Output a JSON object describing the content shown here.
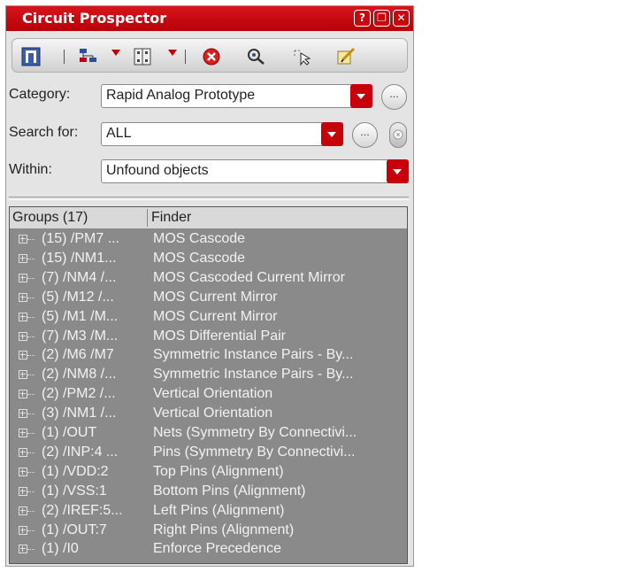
{
  "window": {
    "title": "Circuit Prospector",
    "help_glyph": "?",
    "restore_glyph": "❐",
    "close_glyph": "✕"
  },
  "toolbar": {
    "icons": [
      "probe-icon",
      "hierarchy-icon",
      "dropdown-icon",
      "grid-icon",
      "dropdown-icon",
      "stop-icon",
      "find-icon",
      "select-icon",
      "edit-icon"
    ]
  },
  "filters": {
    "category_label": "Category:",
    "category_value": "Rapid Analog Prototype",
    "search_label": "Search for:",
    "search_value": "ALL",
    "within_label": "Within:",
    "within_value": "Unfound objects",
    "more_glyph": "..."
  },
  "table": {
    "col_groups": "Groups (17)",
    "col_finder": "Finder",
    "rows": [
      {
        "group": "(15)  /PM7 ...",
        "finder": "MOS Cascode"
      },
      {
        "group": "(15)  /NM1...",
        "finder": "MOS Cascode"
      },
      {
        "group": "(7)  /NM4 /...",
        "finder": "MOS Cascoded Current Mirror"
      },
      {
        "group": "(5)  /M12 /...",
        "finder": "MOS Current Mirror"
      },
      {
        "group": "(5)  /M1 /M...",
        "finder": "MOS Current Mirror"
      },
      {
        "group": "(7)  /M3 /M...",
        "finder": "MOS Differential Pair"
      },
      {
        "group": "(2)  /M6 /M7",
        "finder": "Symmetric Instance Pairs - By..."
      },
      {
        "group": "(2)  /NM8 /...",
        "finder": "Symmetric Instance Pairs - By..."
      },
      {
        "group": "(2)  /PM2 /...",
        "finder": "Vertical Orientation"
      },
      {
        "group": "(3)  /NM1 /...",
        "finder": "Vertical Orientation"
      },
      {
        "group": "(1)  /OUT",
        "finder": "Nets (Symmetry By Connectivi..."
      },
      {
        "group": "(2)  /INP:4 ...",
        "finder": "Pins (Symmetry By Connectivi..."
      },
      {
        "group": "(1)  /VDD:2",
        "finder": "Top Pins (Alignment)"
      },
      {
        "group": "(1)  /VSS:1",
        "finder": "Bottom Pins (Alignment)"
      },
      {
        "group": "(2)  /IREF:5...",
        "finder": "Left Pins (Alignment)"
      },
      {
        "group": "(1)  /OUT:7",
        "finder": "Right Pins (Alignment)"
      },
      {
        "group": "(1)  /I0",
        "finder": "Enforce Precedence"
      }
    ]
  },
  "colors": {
    "titlebar": "#c8000a",
    "list_bg": "#8a8a8a",
    "accent": "#c8000a"
  }
}
